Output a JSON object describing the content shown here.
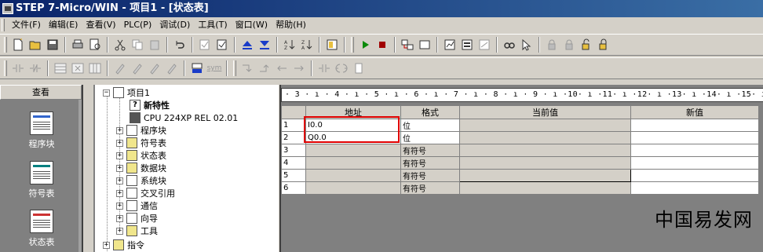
{
  "window": {
    "title": "STEP 7-Micro/WIN - 项目1 - [状态表]"
  },
  "menu": [
    "文件(F)",
    "编辑(E)",
    "查看(V)",
    "PLC(P)",
    "调试(D)",
    "工具(T)",
    "窗口(W)",
    "帮助(H)"
  ],
  "toolbar2": {
    "sym_label": "sym"
  },
  "navbar": {
    "header": "查看",
    "items": [
      {
        "label": "程序块",
        "icon": "program-block-icon"
      },
      {
        "label": "符号表",
        "icon": "symbol-table-icon"
      },
      {
        "label": "状态表",
        "icon": "status-chart-icon"
      }
    ]
  },
  "tree": {
    "project": "项目1",
    "whats_new": "新特性",
    "cpu": "CPU 224XP REL 02.01",
    "nodes": [
      "程序块",
      "符号表",
      "状态表",
      "数据块",
      "系统块",
      "交叉引用",
      "通信",
      "向导",
      "工具"
    ],
    "instructions": "指令"
  },
  "ruler": {
    "text": "· 3 · ı · 4 · ı · 5 · ı · 6 · ı · 7 · ı · 8 · ı · 9 · ı ·10· ı ·11· ı ·12· ı ·13· ı ·14· ı ·15· ı ·16· ı ·17· ı ·18·"
  },
  "status_table": {
    "columns": [
      "地址",
      "格式",
      "当前值",
      "新值"
    ],
    "rows": [
      {
        "num": "1",
        "address": "I0.0",
        "format": "位",
        "current": "",
        "new": ""
      },
      {
        "num": "2",
        "address": "Q0.0",
        "format": "位",
        "current": "",
        "new": ""
      },
      {
        "num": "3",
        "address": "",
        "format": "有符号",
        "current": "",
        "new": ""
      },
      {
        "num": "4",
        "address": "",
        "format": "有符号",
        "current": "",
        "new": ""
      },
      {
        "num": "5",
        "address": "",
        "format": "有符号",
        "current": "",
        "new": ""
      },
      {
        "num": "6",
        "address": "",
        "format": "有符号",
        "current": "",
        "new": ""
      }
    ]
  },
  "watermark": {
    "text": "中国易发网"
  },
  "colors": {
    "highlight": "#e00000",
    "titlebar": "#0a246a"
  }
}
